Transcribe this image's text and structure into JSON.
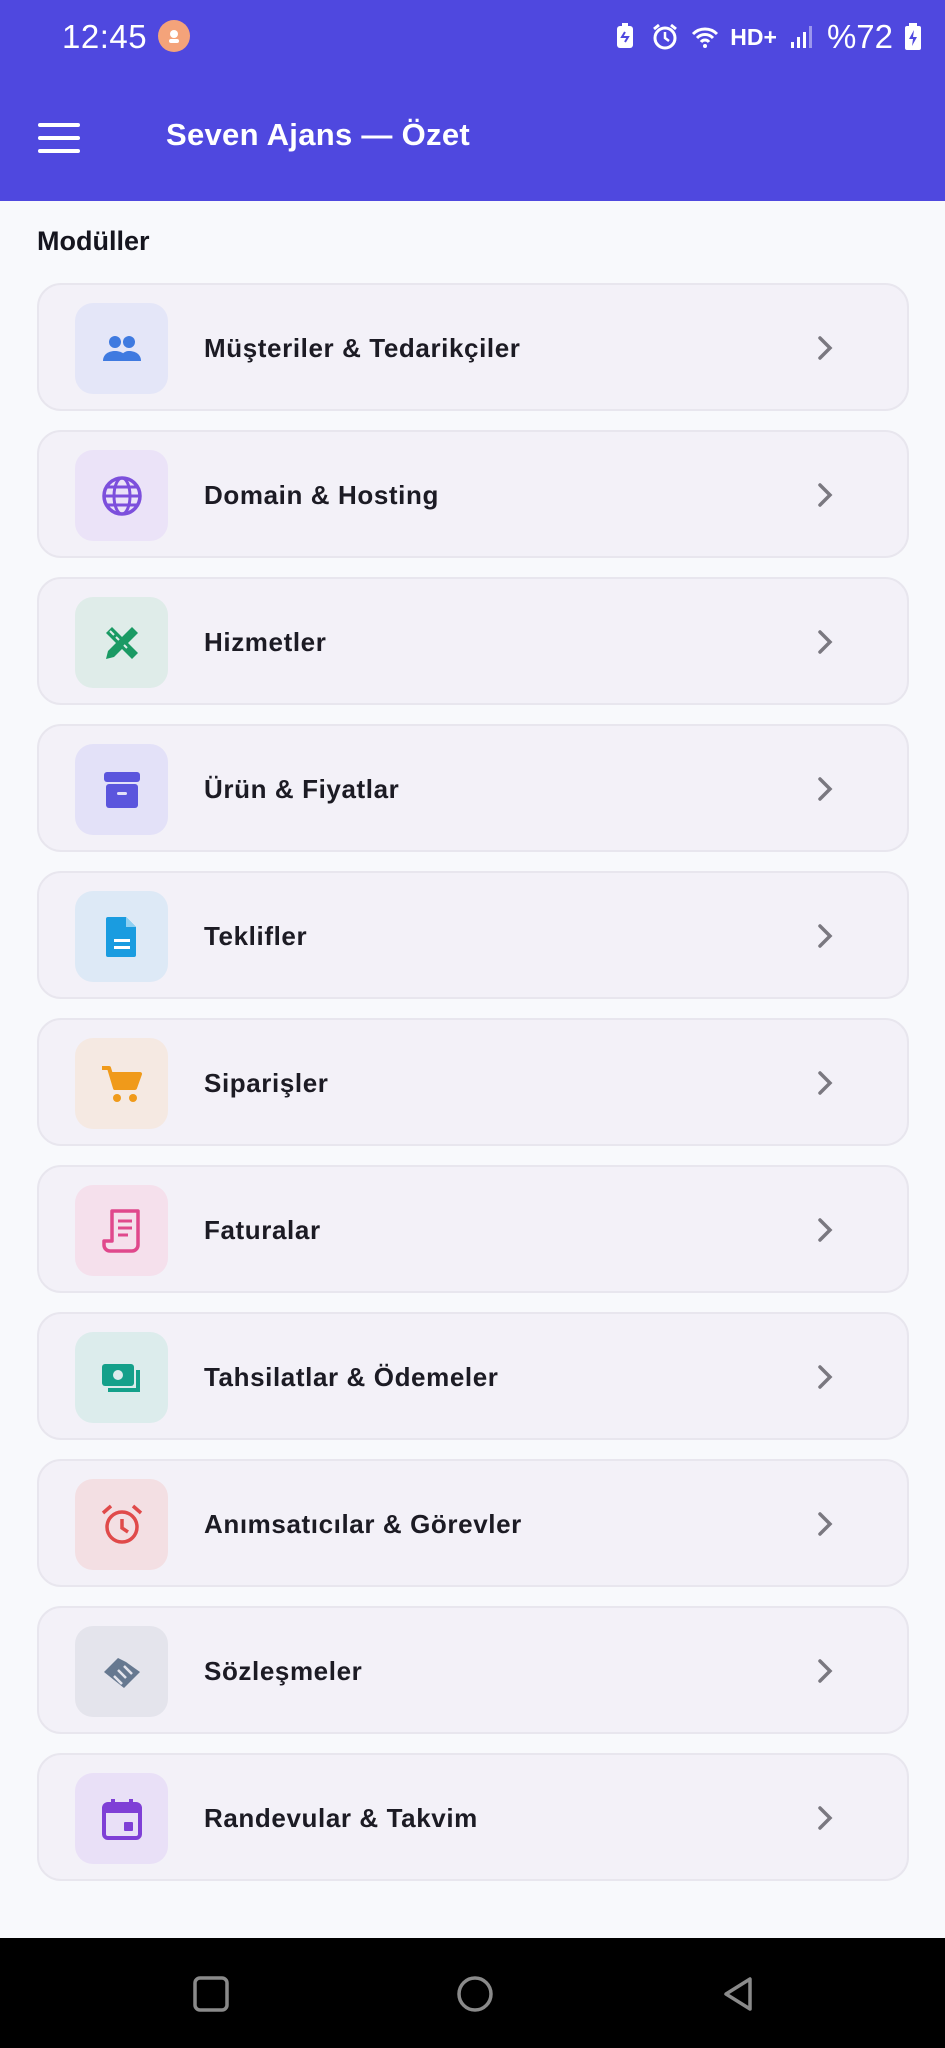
{
  "status_bar": {
    "time": "12:45",
    "network": "HD+",
    "battery": "%72"
  },
  "app_bar": {
    "title": "Seven Ajans — Özet",
    "menu_icon": "hamburger-menu-icon"
  },
  "section": {
    "title": "Modüller"
  },
  "modules": [
    {
      "label": "Müşteriler & Tedarikçiler",
      "icon": "people-icon",
      "color": "#3f7ae0",
      "bg": "#e4e6f8"
    },
    {
      "label": "Domain & Hosting",
      "icon": "globe-icon",
      "color": "#7c4fdc",
      "bg": "#ebe3f8"
    },
    {
      "label": "Hizmetler",
      "icon": "design-tools-icon",
      "color": "#1a9a64",
      "bg": "#dfece9"
    },
    {
      "label": "Ürün & Fiyatlar",
      "icon": "archive-box-icon",
      "color": "#5b55dd",
      "bg": "#e3e1f8"
    },
    {
      "label": "Teklifler",
      "icon": "document-icon",
      "color": "#1a9ce0",
      "bg": "#dde9f6"
    },
    {
      "label": "Siparişler",
      "icon": "shopping-cart-icon",
      "color": "#f09a1a",
      "bg": "#f5e9e2"
    },
    {
      "label": "Faturalar",
      "icon": "receipt-icon",
      "color": "#e0488c",
      "bg": "#f5e0ec"
    },
    {
      "label": "Tahsilatlar & Ödemeler",
      "icon": "payments-icon",
      "color": "#14a08a",
      "bg": "#dcecec"
    },
    {
      "label": "Anımsatıcılar & Görevler",
      "icon": "alarm-clock-icon",
      "color": "#e04a4a",
      "bg": "#f3dfe3"
    },
    {
      "label": "Sözleşmeler",
      "icon": "handshake-icon",
      "color": "#667890",
      "bg": "#e4e4ec"
    },
    {
      "label": "Randevular & Takvim",
      "icon": "calendar-icon",
      "color": "#7f3fd6",
      "bg": "#e9e0f7"
    }
  ],
  "nav_bar": {
    "icons": [
      "recents-square-icon",
      "home-circle-icon",
      "back-triangle-icon"
    ]
  }
}
